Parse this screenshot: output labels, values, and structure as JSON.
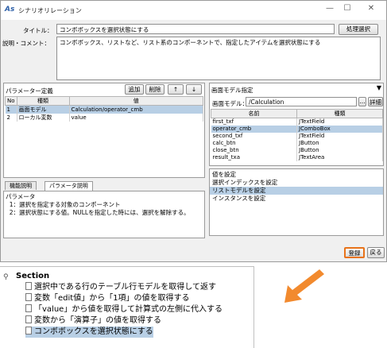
{
  "window": {
    "logo": "As",
    "title": "シナリオリレーション",
    "controls": [
      "—",
      "☐",
      "✕"
    ]
  },
  "form": {
    "title_label": "タイトル：",
    "title_value": "コンボボックスを選択状態にする",
    "process_button": "処理選択",
    "desc_label": "説明・コメント：",
    "desc_value": "コンボボックス、リストなど、リスト系のコンポーネントで、指定したアイテムを選択状態にする"
  },
  "params": {
    "header": "パラメーター定義",
    "add_button": "追加",
    "delete_button": "削除",
    "up_button": "↑",
    "down_button": "↓",
    "columns": [
      "No",
      "種類",
      "値"
    ],
    "rows": [
      [
        "1",
        "画面モデル",
        "Calculation/operator_cmb"
      ],
      [
        "2",
        "ローカル変数",
        "value"
      ]
    ]
  },
  "model": {
    "header": "画面モデル指定",
    "model_label": "画面モデル：",
    "model_value": "/Calculation",
    "dots_button": "...",
    "detail_button": "詳細",
    "columns": [
      "名前",
      "種類"
    ],
    "rows": [
      [
        "first_txf",
        "JTextField"
      ],
      [
        "operator_cmb",
        "JComboBox"
      ],
      [
        "second_txf",
        "JTextField"
      ],
      [
        "calc_btn",
        "JButton"
      ],
      [
        "close_btn",
        "JButton"
      ],
      [
        "result_txa",
        "JTextArea"
      ]
    ]
  },
  "methods": {
    "items": [
      "値を設定",
      "選択インデックスを設定",
      "リストモデルを設定",
      "インスタンスを設定"
    ]
  },
  "desc_tabs": {
    "tabs": [
      "機能説明",
      "パラメータ説明"
    ],
    "lines": [
      "パラメータ",
      "  1：選択を指定する対象のコンポーネント",
      "  2：選択状態にする値。NULLを指定した時には、選択を解除する。"
    ]
  },
  "footer": {
    "register_button": "登録",
    "back_button": "戻る"
  },
  "tree": {
    "root": "Section",
    "items": [
      "選択中である行のテーブル行モデルを取得して返す",
      "変数「edit値」から「1項」の値を取得する",
      "「value」から値を取得して計算式の左側に代入する",
      "変数から「演算子」の値を取得する",
      "コンボボックスを選択状態にする"
    ]
  },
  "colors": {
    "selection": "#b8cfe5",
    "accent_arrow": "#f28a2e",
    "highlight_border": "#e8731a"
  }
}
